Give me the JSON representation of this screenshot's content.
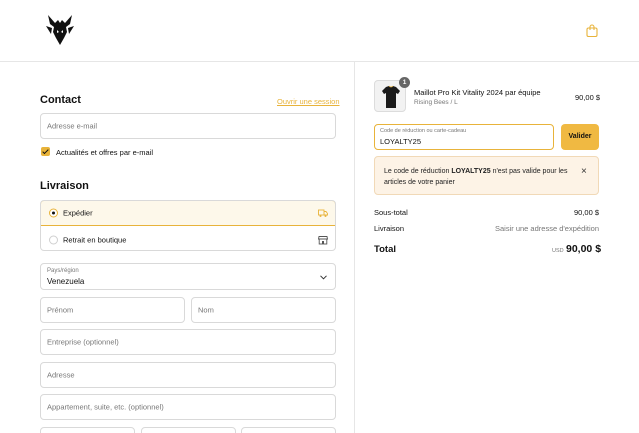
{
  "colors": {
    "accent": "#e8b33a",
    "button": "#f0b942",
    "alert_bg": "#fdf3e6"
  },
  "header": {
    "logo_icon": "vitality-wasp-logo-icon",
    "cart_icon": "shopping-bag-icon"
  },
  "contact": {
    "title": "Contact",
    "login_link": "Ouvrir une session",
    "email_placeholder": "Adresse e-mail",
    "newsletter_label": "Actualités et offres par e-mail",
    "newsletter_checked": true
  },
  "delivery": {
    "title": "Livraison",
    "options": [
      {
        "label": "Expédier",
        "icon": "truck-icon",
        "selected": true
      },
      {
        "label": "Retrait en boutique",
        "icon": "store-icon",
        "selected": false
      }
    ],
    "country_label": "Pays/région",
    "country_value": "Venezuela",
    "first_name_placeholder": "Prénom",
    "last_name_placeholder": "Nom",
    "company_placeholder": "Entreprise (optionnel)",
    "address_placeholder": "Adresse",
    "apartment_placeholder": "Appartement, suite, etc. (optionnel)"
  },
  "cart": {
    "item": {
      "quantity": "1",
      "name": "Maillot Pro Kit Vitality 2024 par équipe",
      "variant": "Rising Bees / L",
      "price": "90,00 $"
    },
    "discount_label": "Code de réduction ou carte-cadeau",
    "discount_value": "LOYALTY25",
    "apply_label": "Valider",
    "alert_prefix": "Le code de réduction ",
    "alert_code": "LOYALTY25",
    "alert_suffix": " n'est pas valide pour les articles de votre panier",
    "subtotal_label": "Sous-total",
    "subtotal_value": "90,00 $",
    "shipping_label": "Livraison",
    "shipping_value": "Saisir une adresse d'expédition",
    "total_label": "Total",
    "total_currency": "USD",
    "total_value": "90,00 $"
  }
}
